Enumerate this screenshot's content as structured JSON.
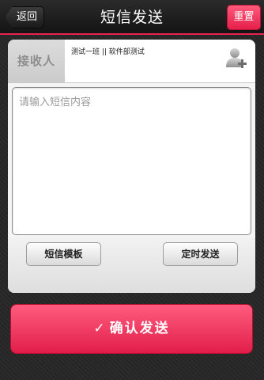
{
  "header": {
    "back_label": "返回",
    "title": "短信发送",
    "reset_label": "重置"
  },
  "recipient": {
    "label": "接收人",
    "names": "测试一班 || 软件部测试",
    "add_icon": "add-contact-icon"
  },
  "message": {
    "placeholder": "请输入短信内容",
    "value": ""
  },
  "actions": {
    "template_label": "短信模板",
    "scheduled_label": "定时发送",
    "confirm_label": "确认发送",
    "confirm_icon": "✓"
  },
  "colors": {
    "accent": "#e8234f",
    "background": "#252525",
    "card": "#f4f4f4"
  }
}
